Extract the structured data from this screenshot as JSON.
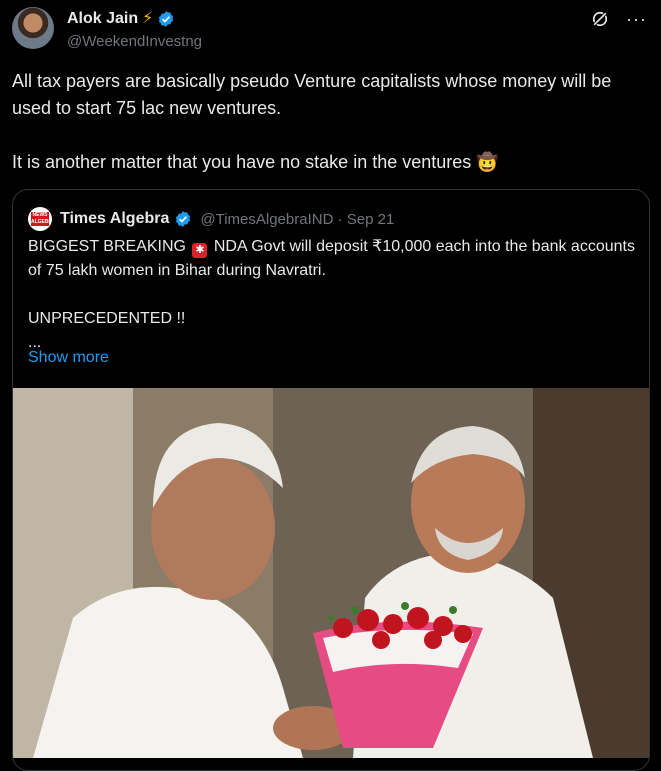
{
  "author": {
    "name": "Alok Jain",
    "handle": "@WeekendInvestng"
  },
  "post": {
    "line1": "All tax payers are basically pseudo Venture capitalists whose money will be used to start 75 lac new ventures.",
    "line2": "It is another matter that you have no stake in the ventures 🤠"
  },
  "quoted": {
    "name": "Times Algebra",
    "meta": "@TimesAlgebraIND · Sep 21",
    "text1a": "BIGGEST BREAKING",
    "text1b": "NDA Govt will deposit ₹10,000 each into the bank accounts of 75 lakh women in Bihar during Navratri.",
    "text2": "UNPRECEDENTED !!",
    "text3": "...",
    "show_more": "Show more",
    "logo_text": "NEWS ALGEBRA"
  },
  "icons": {
    "bolt": "⚡",
    "more": "···",
    "siren": "🚨"
  },
  "colors": {
    "accent": "#1d9bf0",
    "verified": "#1d9bf0",
    "secondary_text": "#71767b",
    "border": "#2f3336"
  }
}
